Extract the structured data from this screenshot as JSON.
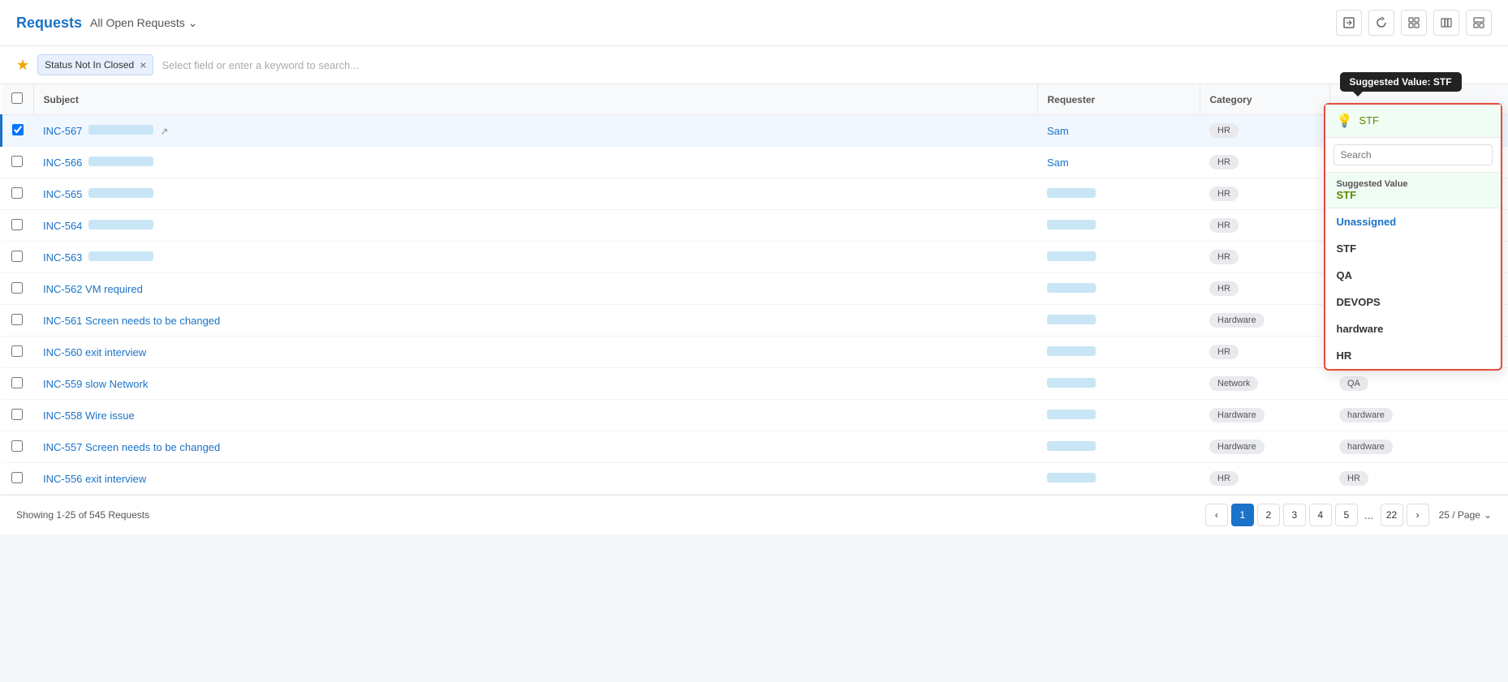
{
  "header": {
    "title": "Requests",
    "subtitle": "All Open Requests",
    "icons": [
      "export-icon",
      "refresh-icon",
      "grid-icon",
      "columns-icon",
      "layout-icon"
    ]
  },
  "filter": {
    "star_label": "★",
    "tag_label": "Status Not In Closed",
    "placeholder": "Select field or enter a keyword to search..."
  },
  "table": {
    "columns": [
      "Subject",
      "Requester",
      "Category"
    ],
    "rows": [
      {
        "id": "INC-567",
        "subject_extra": "",
        "requester": "Sam",
        "requester_link": true,
        "category": "HR",
        "group": "STF",
        "is_selected": true
      },
      {
        "id": "INC-566",
        "subject_extra": "",
        "requester": "Sam",
        "requester_link": true,
        "category": "HR",
        "group": "",
        "is_selected": false
      },
      {
        "id": "INC-565",
        "subject_extra": "",
        "requester": "",
        "requester_link": false,
        "category": "HR",
        "group": "",
        "is_selected": false
      },
      {
        "id": "INC-564",
        "subject_extra": "",
        "requester": "",
        "requester_link": false,
        "category": "HR",
        "group": "",
        "is_selected": false
      },
      {
        "id": "INC-563",
        "subject_extra": "",
        "requester": "",
        "requester_link": false,
        "category": "HR",
        "group": "",
        "is_selected": false
      },
      {
        "id": "INC-562",
        "subject_extra": "VM required",
        "requester": "",
        "requester_link": false,
        "category": "HR",
        "group": "",
        "is_selected": false
      },
      {
        "id": "INC-561",
        "subject_extra": "Screen needs to be changed",
        "requester": "",
        "requester_link": false,
        "category": "Hardware",
        "group": "",
        "is_selected": false
      },
      {
        "id": "INC-560",
        "subject_extra": "exit interview",
        "requester": "",
        "requester_link": false,
        "category": "HR",
        "group": "",
        "is_selected": false
      },
      {
        "id": "INC-559",
        "subject_extra": "slow Network",
        "requester": "",
        "requester_link": false,
        "category": "Network",
        "group": "QA",
        "is_selected": false
      },
      {
        "id": "INC-558",
        "subject_extra": "Wire issue",
        "requester": "",
        "requester_link": false,
        "category": "Hardware",
        "group": "hardware",
        "is_selected": false
      },
      {
        "id": "INC-557",
        "subject_extra": "Screen needs to be changed",
        "requester": "",
        "requester_link": false,
        "category": "Hardware",
        "group": "hardware",
        "is_selected": false
      },
      {
        "id": "INC-556",
        "subject_extra": "exit interview",
        "requester": "",
        "requester_link": false,
        "category": "HR",
        "group": "HR",
        "is_selected": false
      }
    ]
  },
  "dropdown": {
    "tooltip": "Suggested Value: STF",
    "suggested_icon": "💡",
    "suggested_value": "STF",
    "search_placeholder": "Search",
    "section_title": "Suggested Value",
    "section_value": "STF",
    "items": [
      "Unassigned",
      "STF",
      "QA",
      "DEVOPS",
      "hardware",
      "HR"
    ]
  },
  "footer": {
    "showing_text": "Showing 1-25 of 545 Requests",
    "pages": [
      1,
      2,
      3,
      4,
      5
    ],
    "ellipsis": "...",
    "last_page": 22,
    "page_size": "25 / Page"
  }
}
